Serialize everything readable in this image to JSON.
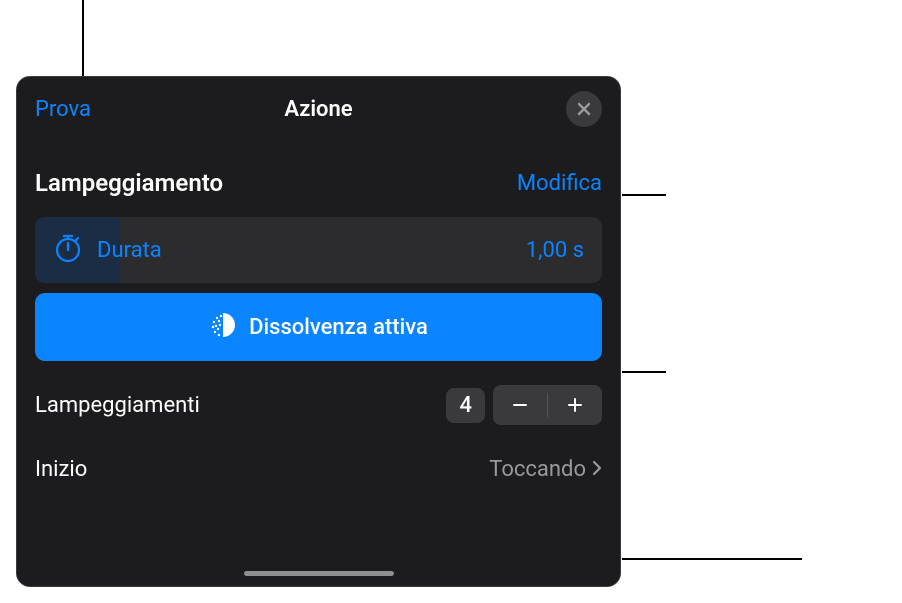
{
  "header": {
    "preview": "Prova",
    "title": "Azione"
  },
  "section": {
    "title": "Lampeggiamento",
    "edit": "Modifica"
  },
  "duration": {
    "label": "Durata",
    "value": "1,00 s"
  },
  "dissolve": {
    "label": "Dissolvenza attiva"
  },
  "count": {
    "label": "Lampeggiamenti",
    "value": "4"
  },
  "start": {
    "label": "Inizio",
    "value": "Toccando"
  }
}
